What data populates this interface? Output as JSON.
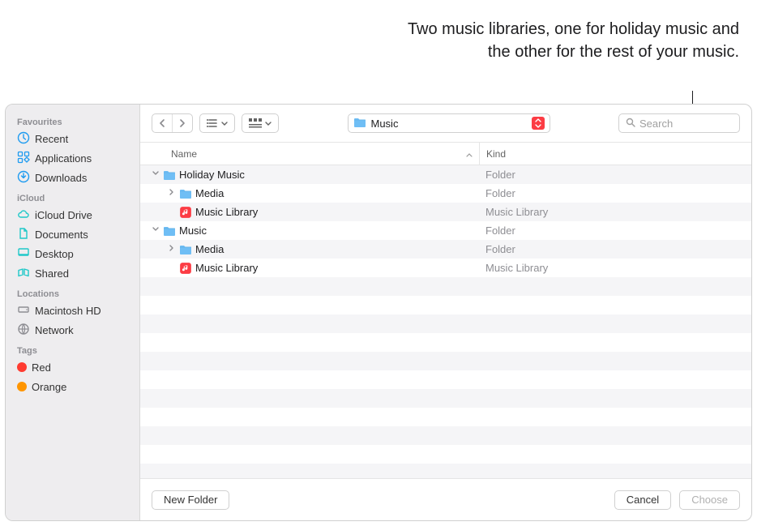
{
  "callout": "Two music libraries, one for holiday music and the other for the rest of your music.",
  "sidebar": {
    "groups": [
      {
        "label": "Favourites",
        "items": [
          {
            "name": "Recent",
            "icon": "clock"
          },
          {
            "name": "Applications",
            "icon": "apps"
          },
          {
            "name": "Downloads",
            "icon": "download"
          }
        ]
      },
      {
        "label": "iCloud",
        "items": [
          {
            "name": "iCloud Drive",
            "icon": "cloud"
          },
          {
            "name": "Documents",
            "icon": "doc"
          },
          {
            "name": "Desktop",
            "icon": "desktop"
          },
          {
            "name": "Shared",
            "icon": "shared"
          }
        ]
      },
      {
        "label": "Locations",
        "items": [
          {
            "name": "Macintosh HD",
            "icon": "hd"
          },
          {
            "name": "Network",
            "icon": "network"
          }
        ]
      },
      {
        "label": "Tags",
        "items": [
          {
            "name": "Red",
            "color": "#ff3b30"
          },
          {
            "name": "Orange",
            "color": "#ff9500"
          }
        ]
      }
    ]
  },
  "toolbar": {
    "path_label": "Music",
    "search_placeholder": "Search"
  },
  "columns": {
    "name": "Name",
    "kind": "Kind"
  },
  "rows": [
    {
      "indent": 0,
      "disclosure": "down",
      "icon": "folder",
      "name": "Holiday Music",
      "kind": "Folder"
    },
    {
      "indent": 1,
      "disclosure": "right",
      "icon": "folder",
      "name": "Media",
      "kind": "Folder"
    },
    {
      "indent": 1,
      "disclosure": "",
      "icon": "library",
      "name": "Music Library",
      "kind": "Music Library"
    },
    {
      "indent": 0,
      "disclosure": "down",
      "icon": "folder",
      "name": "Music",
      "kind": "Folder"
    },
    {
      "indent": 1,
      "disclosure": "right",
      "icon": "folder",
      "name": "Media",
      "kind": "Folder"
    },
    {
      "indent": 1,
      "disclosure": "",
      "icon": "library",
      "name": "Music Library",
      "kind": "Music Library"
    }
  ],
  "footer": {
    "new_folder": "New Folder",
    "cancel": "Cancel",
    "choose": "Choose"
  },
  "colors": {
    "accent": "#1e9bf0",
    "music": "#fc3c44"
  }
}
